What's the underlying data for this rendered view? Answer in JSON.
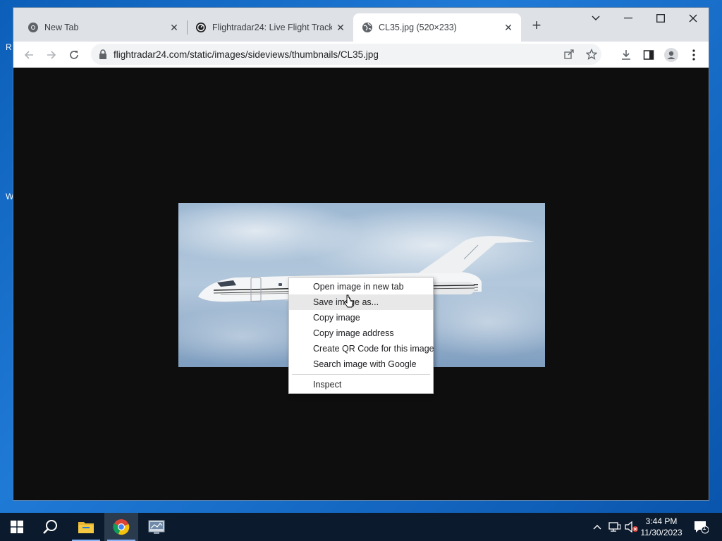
{
  "browser": {
    "tabs": [
      {
        "title": "New Tab",
        "icon": "chrome-icon",
        "active": false
      },
      {
        "title": "Flightradar24: Live Flight Tracker",
        "icon": "flightradar-icon",
        "active": false
      },
      {
        "title": "CL35.jpg (520×233)",
        "icon": "globe-icon",
        "active": true
      }
    ],
    "new_tab_label": "+",
    "address": "flightradar24.com/static/images/sideviews/thumbnails/CL35.jpg"
  },
  "context_menu": {
    "items": [
      "Open image in new tab",
      "Save image as...",
      "Copy image",
      "Copy image address",
      "Create QR Code for this image",
      "Search image with Google"
    ],
    "hovered_index": 1,
    "last_item": "Inspect"
  },
  "taskbar": {
    "time": "3:44 PM",
    "date": "11/30/2023",
    "notification_count": "1"
  },
  "colors": {
    "accent": "#8ab4f8",
    "taskbar": "#0b1a2c",
    "desktop": "#1a6fc9"
  }
}
